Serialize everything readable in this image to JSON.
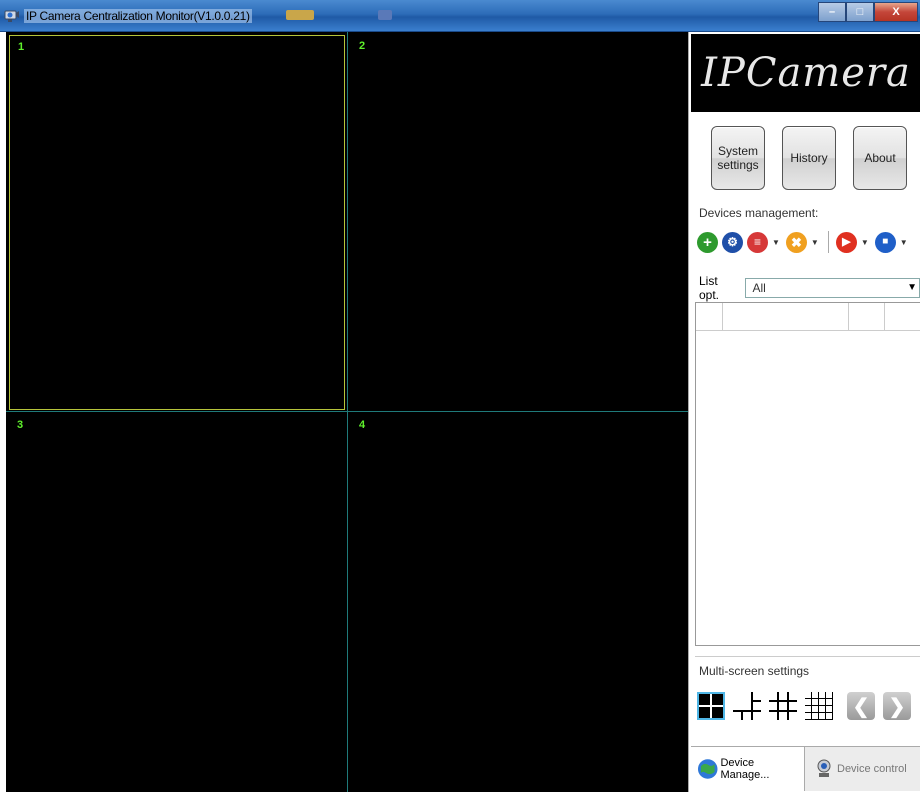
{
  "window": {
    "title": "IP Camera Centralization Monitor(V1.0.0.21)",
    "minimize_glyph": "–",
    "maximize_glyph": "□",
    "close_glyph": "X"
  },
  "video": {
    "cells": [
      {
        "label": "1"
      },
      {
        "label": "2"
      },
      {
        "label": "3"
      },
      {
        "label": "4"
      }
    ],
    "label_color": "#5ff02c"
  },
  "panel": {
    "logo_text": "IPCamera",
    "buttons": {
      "system_settings": "System settings",
      "history": "History",
      "about": "About"
    },
    "devices_management_label": "Devices management:",
    "toolbar_icons": [
      "add-device-icon",
      "search-device-icon",
      "edit-device-icon",
      "delete-device-icon",
      "play-icon",
      "stop-icon"
    ],
    "list_opt_label": "List opt.",
    "list_opt_value": "All",
    "multi_screen_label": "Multi-screen settings",
    "layout_icons": [
      "layout-4-icon",
      "layout-6-icon",
      "layout-9-icon",
      "layout-16-icon",
      "prev-page-icon",
      "next-page-icon"
    ],
    "tabs": [
      {
        "label": "Device Manage...",
        "active": true
      },
      {
        "label": "Device control",
        "active": false
      }
    ]
  }
}
